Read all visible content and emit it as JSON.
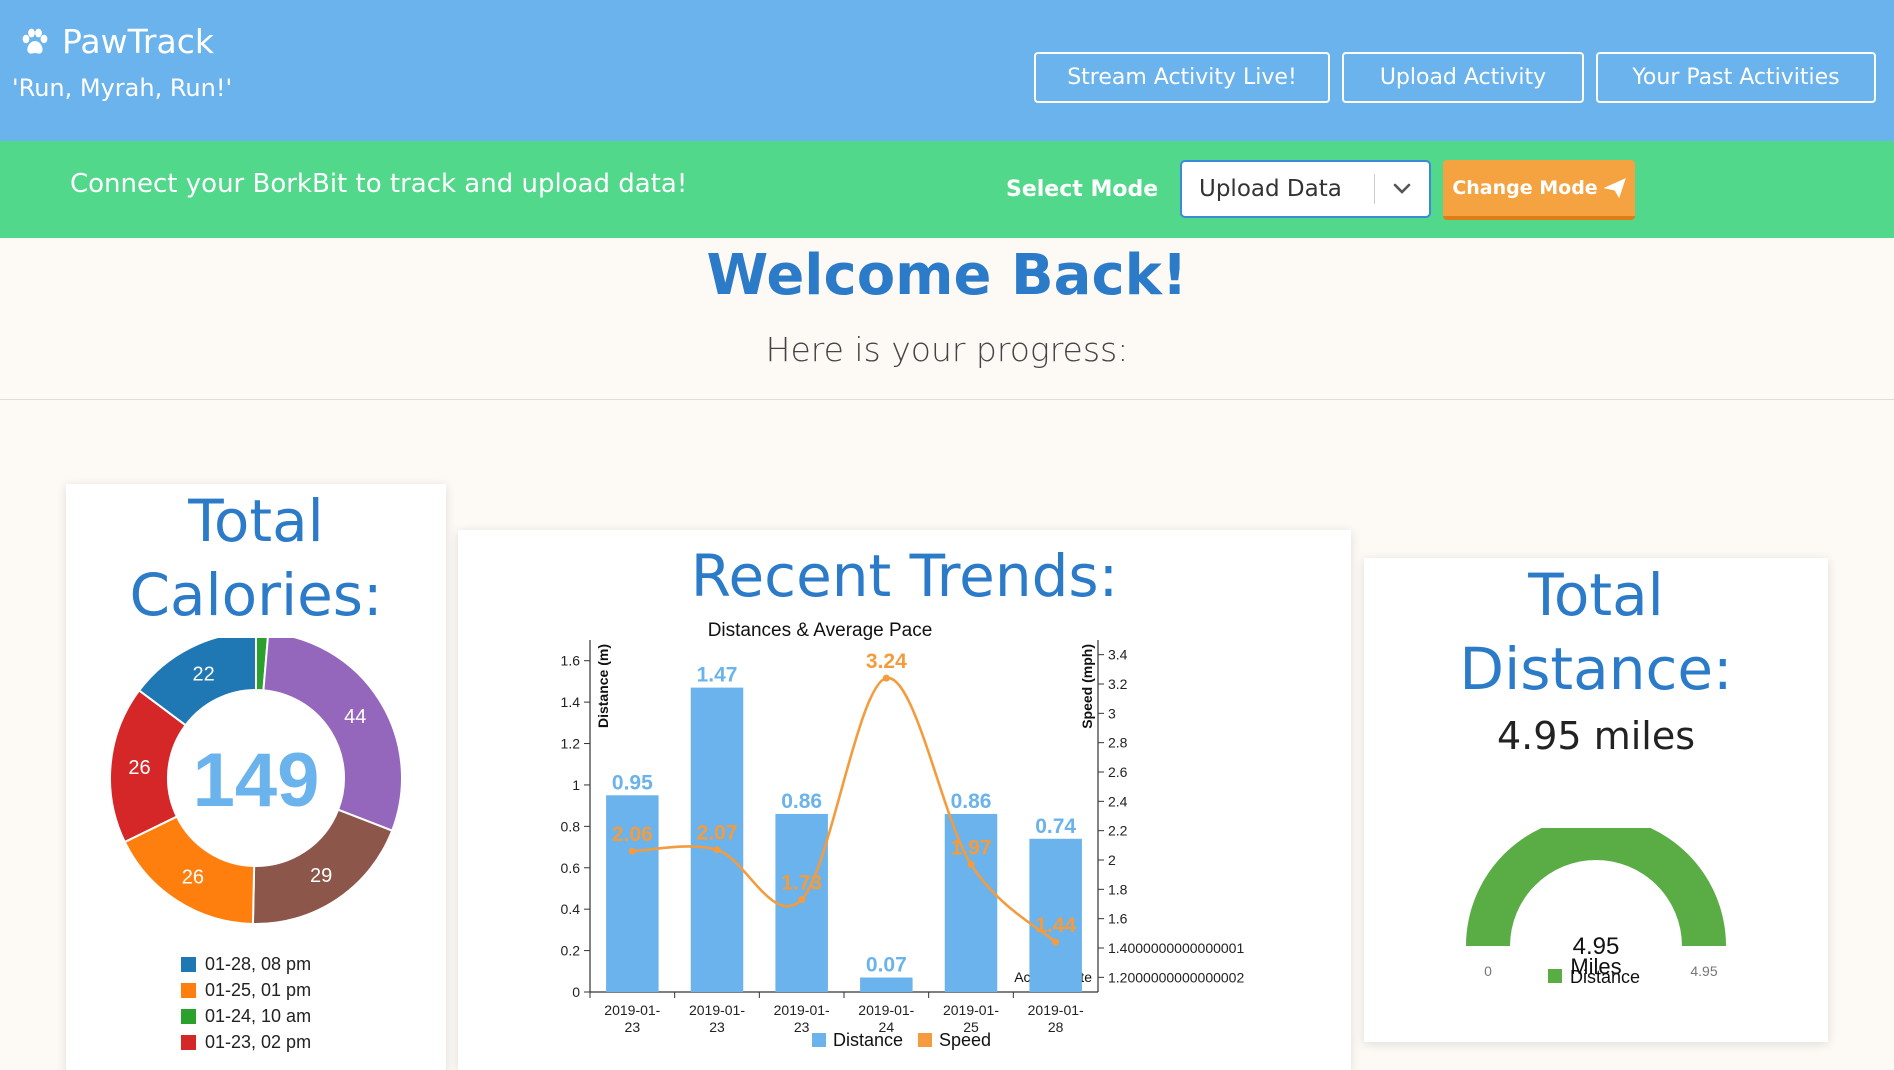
{
  "header": {
    "app_name": "PawTrack",
    "tagline": "'Run, Myrah, Run!'",
    "nav": [
      {
        "label": "Stream Activity Live!"
      },
      {
        "label": "Upload Activity"
      },
      {
        "label": "Your Past Activities"
      }
    ]
  },
  "subbar": {
    "message": "Connect your BorkBit to track and upload data!",
    "select_mode_label": "Select Mode",
    "selected_mode": "Upload Data",
    "change_mode_label": "Change Mode"
  },
  "welcome": {
    "title": "Welcome Back!",
    "subtitle": "Here is your progress:"
  },
  "colors": {
    "header": "#6bb3ec",
    "subbar": "#52d88a",
    "accent": "#2c7bc8",
    "button_orange": "#f4a340",
    "bar_blue": "#6bb3ec",
    "line_orange": "#f49c3d",
    "gauge_green": "#5aac44"
  },
  "calories": {
    "title_line1": "Total",
    "title_line2": "Calories:",
    "total": "149"
  },
  "trends": {
    "title": "Recent Trends:"
  },
  "distance": {
    "title_line1": "Total",
    "title_line2": "Distance:",
    "value_text": "4.95 miles"
  },
  "chart_data": [
    {
      "type": "pie",
      "variant": "donut",
      "center_label": "149",
      "slices": [
        {
          "label": "01-28, 08 pm",
          "value": 22,
          "color": "#1f77b4"
        },
        {
          "label": "01-25, 01 pm",
          "value": 26,
          "color": "#ff7f0e"
        },
        {
          "label": "01-24, 10 am",
          "value": 2,
          "color": "#2ca02c"
        },
        {
          "label": "01-23, 02 pm",
          "value": 26,
          "color": "#d62728"
        },
        {
          "label": "",
          "value": 44,
          "color": "#9467bd"
        },
        {
          "label": "",
          "value": 29,
          "color": "#8c564b"
        }
      ],
      "draw_order": [
        2,
        4,
        5,
        1,
        3,
        0
      ],
      "legend": [
        "01-28, 08 pm",
        "01-25, 01 pm",
        "01-24, 10 am",
        "01-23, 02 pm"
      ]
    },
    {
      "type": "bar",
      "title": "Distances & Average Pace",
      "xlabel": "Activity Date",
      "ylabel": "Distance (m)",
      "y2label": "Speed (mph)",
      "categories": [
        "2019-01-23",
        "2019-01-23",
        "2019-01-23",
        "2019-01-24",
        "2019-01-25",
        "2019-01-28"
      ],
      "series": [
        {
          "name": "Distance",
          "type": "bar",
          "values": [
            0.95,
            1.47,
            0.86,
            0.07,
            0.86,
            0.74
          ],
          "color": "#6bb3ec"
        },
        {
          "name": "Speed",
          "type": "line",
          "axis": "right",
          "values": [
            2.06,
            2.07,
            1.73,
            3.24,
            1.97,
            1.44
          ],
          "color": "#f49c3d"
        }
      ],
      "ylim": [
        0,
        1.7
      ],
      "y2lim": [
        1.1,
        3.5
      ],
      "yticks": [
        "0",
        "0.2",
        "0.4",
        "0.6",
        "0.8",
        "1",
        "1.2",
        "1.4",
        "1.6"
      ],
      "yticks_values": [
        0,
        0.2,
        0.4,
        0.6,
        0.8,
        1.0,
        1.2,
        1.4,
        1.6
      ],
      "y2ticks": [
        "1.2000000000000002",
        "1.4000000000000001",
        "1.6",
        "1.8",
        "2",
        "2.2",
        "2.4",
        "2.6",
        "2.8",
        "3",
        "3.2",
        "3.4"
      ],
      "y2ticks_values": [
        1.2,
        1.4,
        1.6,
        1.8,
        2.0,
        2.2,
        2.4,
        2.6,
        2.8,
        3.0,
        3.2,
        3.4
      ],
      "legend": [
        "Distance",
        "Speed"
      ]
    },
    {
      "type": "gauge",
      "value": 4.95,
      "min": 0,
      "max": 4.95,
      "min_label": "0",
      "max_label": "4.95",
      "center_value": "4.95",
      "center_unit": "Miles",
      "legend": "Distance",
      "color": "#5aac44"
    }
  ]
}
